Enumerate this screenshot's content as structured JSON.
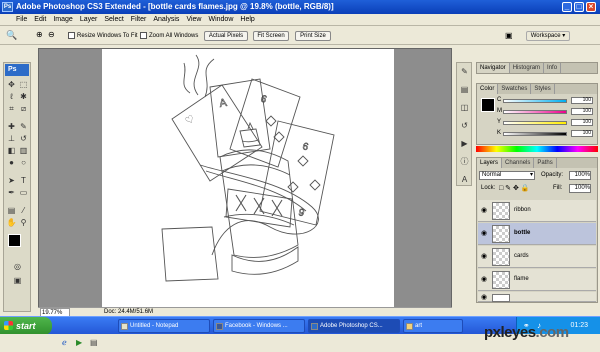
{
  "window": {
    "title": "Adobe Photoshop CS3 Extended - [bottle cards flames.jpg @ 19.8% (bottle, RGB/8)]",
    "app_badge": "Ps",
    "controls": [
      "_",
      "□",
      "×"
    ]
  },
  "menu": [
    "File",
    "Edit",
    "Image",
    "Layer",
    "Select",
    "Filter",
    "Analysis",
    "View",
    "Window",
    "Help"
  ],
  "options": {
    "resize_windows": "Resize Windows To Fit",
    "zoom_all": "Zoom All Windows",
    "actual_pixels": "Actual Pixels",
    "fit_screen": "Fit Screen",
    "print_size": "Print Size",
    "workspace": "Workspace ▾"
  },
  "status": {
    "zoom": "19.77%",
    "doc": "Doc: 24.4M/51.6M"
  },
  "panels": {
    "nav_tabs": [
      "Navigator",
      "Histogram",
      "Info"
    ],
    "color_tabs": [
      "Color",
      "Swatches",
      "Styles"
    ],
    "color_channels": [
      {
        "label": "C",
        "value": "100"
      },
      {
        "label": "M",
        "value": "100"
      },
      {
        "label": "Y",
        "value": "100"
      },
      {
        "label": "K",
        "value": "100"
      }
    ],
    "layers_tabs": [
      "Layers",
      "Channels",
      "Paths"
    ],
    "blend_mode": "Normal",
    "opacity_label": "Opacity:",
    "opacity_value": "100%",
    "lock_label": "Lock:",
    "fill_label": "Fill:",
    "fill_value": "100%",
    "layers": [
      {
        "name": "ribbon",
        "selected": false
      },
      {
        "name": "bottle",
        "selected": true
      },
      {
        "name": "cards",
        "selected": false
      },
      {
        "name": "flame",
        "selected": false
      }
    ]
  },
  "taskbar": {
    "start": "start",
    "tasks": [
      "Untitled - Notepad",
      "Facebook - Windows ...",
      "Adobe Photoshop CS...",
      "art"
    ],
    "clock": "01:23"
  },
  "watermark": {
    "brand": "pxleyes",
    "tld": ".com"
  }
}
